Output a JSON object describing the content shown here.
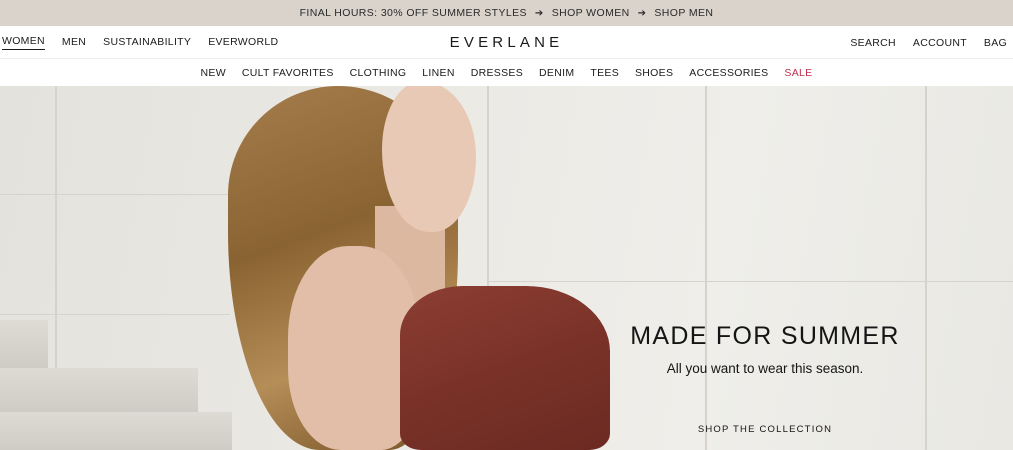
{
  "promo": {
    "text": "FINAL HOURS: 30% OFF SUMMER STYLES",
    "arrow1": "➔",
    "link_women": "SHOP WOMEN",
    "arrow2": "➔",
    "link_men": "SHOP MEN"
  },
  "header": {
    "left_nav": [
      "WOMEN",
      "MEN",
      "SUSTAINABILITY",
      "EVERWORLD"
    ],
    "active_item": "WOMEN",
    "logo": "EVERLANE",
    "right_nav": [
      "SEARCH",
      "ACCOUNT",
      "BAG"
    ]
  },
  "category_nav": [
    "NEW",
    "CULT FAVORITES",
    "CLOTHING",
    "LINEN",
    "DRESSES",
    "DENIM",
    "TEES",
    "SHOES",
    "ACCESSORIES",
    "SALE"
  ],
  "colors": {
    "promo_bg": "#d9d3cb",
    "sale": "#c0304f",
    "text": "#1b1b1b"
  },
  "hero": {
    "title": "MADE FOR SUMMER",
    "subtitle": "All you want to wear this season.",
    "cta": "SHOP THE COLLECTION"
  }
}
